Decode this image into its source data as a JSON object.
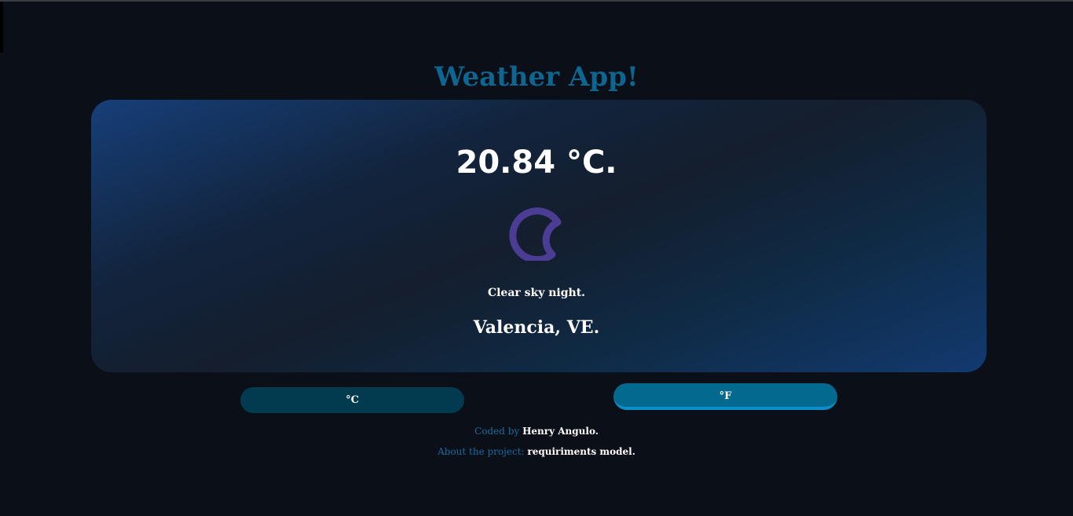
{
  "app": {
    "title": "Weather App!"
  },
  "weather": {
    "temperature": "20.84 °C.",
    "icon": "crescent-moon-icon",
    "description": "Clear sky night.",
    "location": "Valencia, VE."
  },
  "units": {
    "celsius_label": "°C",
    "fahrenheit_label": "°F",
    "active": "fahrenheit"
  },
  "footer": {
    "coded_by_label": "Coded by",
    "author": "Henry Angulo.",
    "about_label": "About the project:",
    "about_link": "requiriments model."
  },
  "colors": {
    "background": "#0b0f17",
    "title": "#0e6590",
    "moon": "#4b3d94",
    "celsius_button": "#023a50",
    "fahrenheit_button": "#03698f",
    "footer_label": "#1b6aa0"
  }
}
